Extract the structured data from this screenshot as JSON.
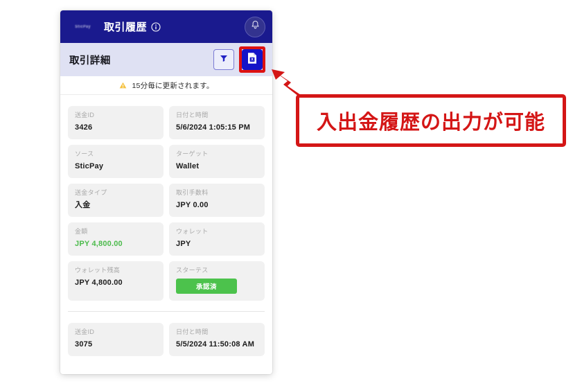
{
  "app": {
    "brand_logo_text": "SticPay",
    "title": "取引履歴",
    "info_icon": "info-circle-icon",
    "bell_icon": "bell-icon"
  },
  "toolbar": {
    "section_title": "取引詳細",
    "filter_icon": "funnel-filter-icon",
    "export_icon": "excel-file-icon",
    "highlight_color": "#dd1111"
  },
  "notice": {
    "icon": "warning-triangle-icon",
    "text": "15分毎に更新されます。"
  },
  "labels": {
    "transfer_id": "送金ID",
    "date_time": "日付と時間",
    "source": "ソース",
    "target": "ターゲット",
    "transfer_type": "送金タイプ",
    "transaction_fee": "取引手数料",
    "amount": "金額",
    "wallet": "ウォレット",
    "wallet_balance": "ウォレット残高",
    "status": "スターテス"
  },
  "transactions": [
    {
      "transfer_id": "3426",
      "date_time": "5/6/2024 1:05:15 PM",
      "source": "SticPay",
      "target": "Wallet",
      "transfer_type": "入金",
      "transaction_fee": "JPY 0.00",
      "amount": "JPY 4,800.00",
      "wallet": "JPY",
      "wallet_balance": "JPY 4,800.00",
      "status": "承認済"
    },
    {
      "transfer_id": "3075",
      "date_time": "5/5/2024 11:50:08 AM"
    }
  ],
  "annotation": {
    "text": "入出金履歴の出力が可能",
    "color": "#d41616",
    "arrow_icon": "arrow-up-left-icon"
  },
  "colors": {
    "header_navy": "#1a1a8e",
    "subheader_lavender": "#dfe1f3",
    "export_blue": "#1414c8",
    "amount_green": "#4cbb4c",
    "status_green": "#4cc24c",
    "card_gray": "#f1f1f1"
  }
}
